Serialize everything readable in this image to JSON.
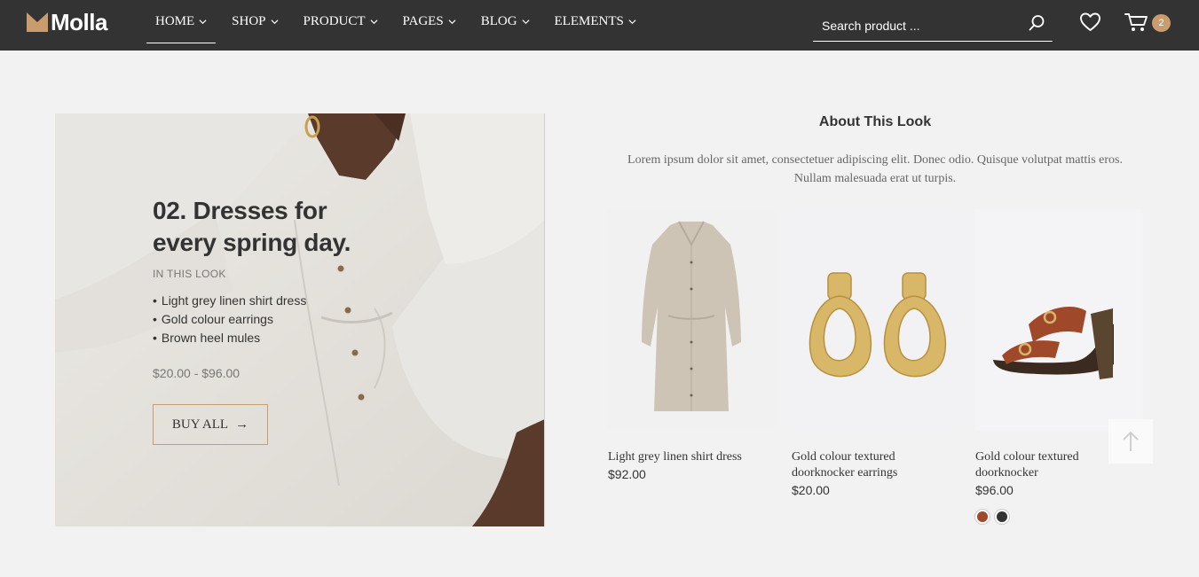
{
  "brand": {
    "name": "Molla",
    "accent": "#c99c6e"
  },
  "nav": {
    "items": [
      {
        "label": "HOME",
        "active": true
      },
      {
        "label": "SHOP",
        "active": false
      },
      {
        "label": "PRODUCT",
        "active": false
      },
      {
        "label": "PAGES",
        "active": false
      },
      {
        "label": "BLOG",
        "active": false
      },
      {
        "label": "ELEMENTS",
        "active": false
      }
    ]
  },
  "search": {
    "placeholder": "Search product ..."
  },
  "cart": {
    "count": "2"
  },
  "hero": {
    "title": "02. Dresses for every spring day.",
    "kicker": "IN THIS LOOK",
    "items": [
      "Light grey linen shirt dress",
      "Gold colour earrings",
      "Brown heel mules"
    ],
    "price": "$20.00 - $96.00",
    "button": "BUY ALL"
  },
  "about": {
    "title": "About This Look",
    "text": "Lorem ipsum dolor sit amet, consectetuer adipiscing elit. Donec odio. Quisque volutpat mattis eros. Nullam malesuada erat ut turpis."
  },
  "products": [
    {
      "name": "Light grey linen shirt dress",
      "price": "$92.00"
    },
    {
      "name": "Gold colour textured doorknocker earrings",
      "price": "$20.00"
    },
    {
      "name": "Gold colour textured doorknocker",
      "price": "$96.00",
      "swatches": [
        "#a0492a",
        "#333333"
      ]
    }
  ]
}
